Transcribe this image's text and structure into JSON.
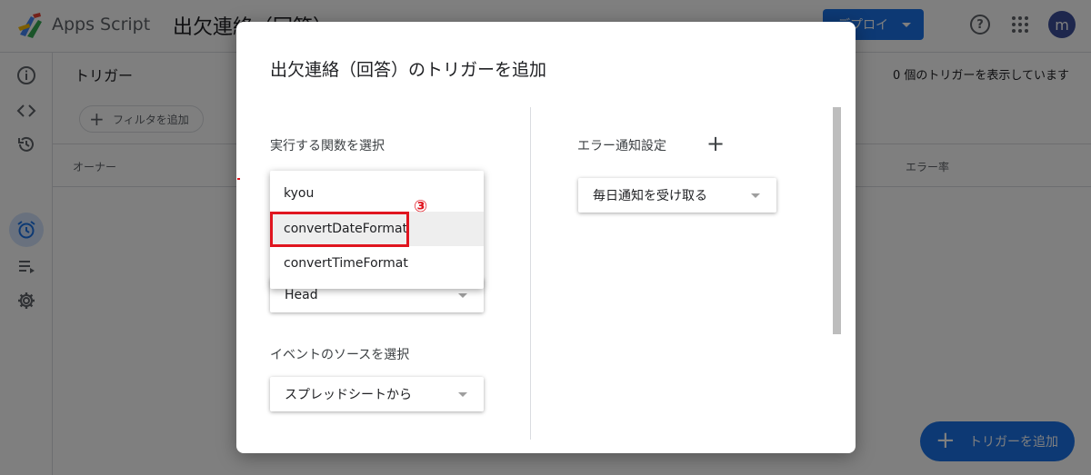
{
  "app": {
    "name": "Apps Script",
    "project_title": "出欠連絡（回答）",
    "deploy_label": "デプロイ",
    "avatar_letter": "m",
    "help_glyph": "?"
  },
  "page": {
    "title": "トリガー",
    "trigger_count": "0 個のトリガーを表示しています",
    "filter_label": "フィルタを追加",
    "columns": {
      "owner": "オーナー",
      "error_rate": "エラー率"
    },
    "fab_label": "トリガーを追加"
  },
  "dialog": {
    "title": "出欠連絡（回答）のトリガーを追加",
    "function_label": "実行する関数を選択",
    "function_options": [
      "kyou",
      "convertDateFormat",
      "convertTimeFormat"
    ],
    "deployment_value": "Head",
    "event_source_label": "イベントのソースを選択",
    "event_source_value": "スプレッドシートから",
    "error_notify_label": "エラー通知設定",
    "error_notify_value": "毎日通知を受け取る",
    "annotation": "③"
  },
  "colors": {
    "primary": "#1a73e8",
    "highlight": "#e0151f",
    "avatar": "#3c4f9b"
  },
  "icons": {
    "sidebar": [
      "info-icon",
      "code-icon",
      "history-icon",
      "alarm-clock-icon",
      "executions-icon",
      "gear-icon"
    ]
  }
}
